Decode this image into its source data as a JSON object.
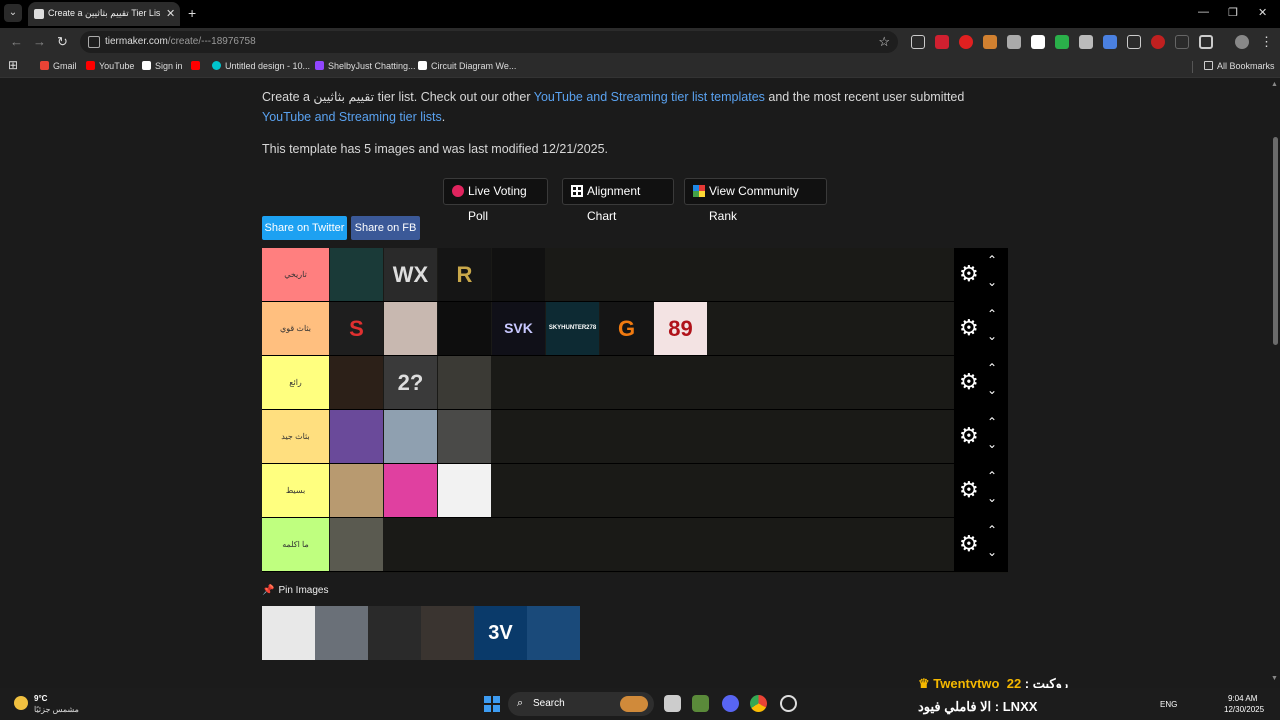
{
  "browser": {
    "tab_title": "Create a تقييم بثاثيين Tier List - T",
    "url_host": "tiermaker.com",
    "url_path": "/create/---18976758",
    "tab_close": "✕",
    "new_tab": "+",
    "back": "←",
    "forward": "→",
    "reload": "↻",
    "bookmark_star": "☆",
    "minimize": "—",
    "restore": "❐",
    "close": "✕",
    "menu": "⋮",
    "tab_menu": "⌄"
  },
  "bookmarks": {
    "apps": "⊞",
    "items": [
      {
        "label": "Gmail",
        "color": "#ea4335"
      },
      {
        "label": "YouTube",
        "color": "#ff0000"
      },
      {
        "label": "Sign in",
        "color": "#ffffff"
      },
      {
        "label": "",
        "color": "#ff0000"
      },
      {
        "label": "Untitled design - 10...",
        "color": "#00c4cc"
      },
      {
        "label": "ShelbyJust Chatting...",
        "color": "#9146ff"
      },
      {
        "label": "Circuit Diagram We...",
        "color": "#ffffff"
      }
    ],
    "all_bookmarks": "All Bookmarks"
  },
  "page": {
    "intro_before": "Create a تقييم بثاثيين tier list. Check out our other ",
    "intro_link1": "YouTube and Streaming tier list templates",
    "intro_middle": " and the most recent user submitted ",
    "intro_link2": "YouTube and Streaming tier lists",
    "intro_end": ".",
    "meta": "This template has 5 images and was last modified 12/21/2025.",
    "buttons": {
      "live_voting": "Live Voting Poll",
      "alignment": "Alignment Chart",
      "community": "View Community Rank"
    },
    "share_twitter": "Share on Twitter",
    "share_fb": "Share on FB",
    "pin_images": "Pin Images"
  },
  "tiers": [
    {
      "label": "تاريخي",
      "color": "#ff7f7f",
      "items": [
        {
          "text": "",
          "bg": "#1a3a38",
          "fg": "#ffffff"
        },
        {
          "text": "WX",
          "bg": "#2a2a2a",
          "fg": "#dddddd"
        },
        {
          "text": "R",
          "bg": "#151515",
          "fg": "#c9a84a"
        },
        {
          "text": "",
          "bg": "#111111",
          "fg": "#e0b060"
        }
      ]
    },
    {
      "label": "بثاث قوي",
      "color": "#ffbf7f",
      "items": [
        {
          "text": "S",
          "bg": "#1e1e1e",
          "fg": "#e03030"
        },
        {
          "text": "",
          "bg": "#c8b8b0",
          "fg": "#ffffff"
        },
        {
          "text": "",
          "bg": "#0e0e0e",
          "fg": "#ffffff"
        },
        {
          "text": "SVK",
          "bg": "#101018",
          "fg": "#c8c8ff"
        },
        {
          "text": "SKYHUNTER278",
          "bg": "#0d2a33",
          "fg": "#ffffff"
        },
        {
          "text": "G",
          "bg": "#151515",
          "fg": "#f07a10"
        },
        {
          "text": "89",
          "bg": "#f3e3e3",
          "fg": "#b0121a"
        }
      ]
    },
    {
      "label": "رائع",
      "color": "#ffff7f",
      "items": [
        {
          "text": "",
          "bg": "#2c2018",
          "fg": "#c0703a"
        },
        {
          "text": "2?",
          "bg": "#3a3a3a",
          "fg": "#dddddd"
        },
        {
          "text": "",
          "bg": "#3b3a35",
          "fg": "#ffffff"
        }
      ]
    },
    {
      "label": "بثاث جيد",
      "color": "#ffdf7f",
      "items": [
        {
          "text": "",
          "bg": "#6a4a9a",
          "fg": "#ffffff"
        },
        {
          "text": "",
          "bg": "#8fa0b0",
          "fg": "#ffffff"
        },
        {
          "text": "",
          "bg": "#4a4a48",
          "fg": "#ffffff"
        }
      ]
    },
    {
      "label": "بسيط",
      "color": "#ffff7f",
      "items": [
        {
          "text": "",
          "bg": "#b89a70",
          "fg": "#ffffff"
        },
        {
          "text": "",
          "bg": "#e040a0",
          "fg": "#ffffff"
        },
        {
          "text": "",
          "bg": "#f2f2f2",
          "fg": "#111111"
        }
      ]
    },
    {
      "label": "ما اكلمه",
      "color": "#bfff7f",
      "items": [
        {
          "text": "",
          "bg": "#5a5a50",
          "fg": "#ffffff"
        }
      ]
    }
  ],
  "tier_controls": {
    "gear": "⚙",
    "up": "⌃",
    "down": "⌄"
  },
  "pinned": [
    {
      "text": "",
      "bg": "#e8e8e8"
    },
    {
      "text": "",
      "bg": "#6a7078"
    },
    {
      "text": "",
      "bg": "#2a2a2a"
    },
    {
      "text": "",
      "bg": "#3a3430"
    },
    {
      "text": "3V",
      "bg": "#0a3a6a"
    },
    {
      "text": "",
      "bg": "#1a4a7a"
    }
  ],
  "overlay": {
    "chat1_user": "Twentytwo_22",
    "chat1_sep": " : ",
    "chat1_msg": "روكيت",
    "chat2_user": "LNXX",
    "chat2_sep": " : ",
    "chat2_msg": "الا فاملي فيود"
  },
  "taskbar": {
    "temp": "9°C",
    "weather_desc": "مشمس جزئيًا",
    "search": "Search",
    "lang": "ENG",
    "time": "9:04 AM",
    "date": "12/30/2025"
  },
  "colors": {
    "accent_link": "#5aa2f0",
    "twitter": "#1da1f2",
    "facebook": "#3b5998",
    "tier_ctrl_bg": "#000000"
  }
}
